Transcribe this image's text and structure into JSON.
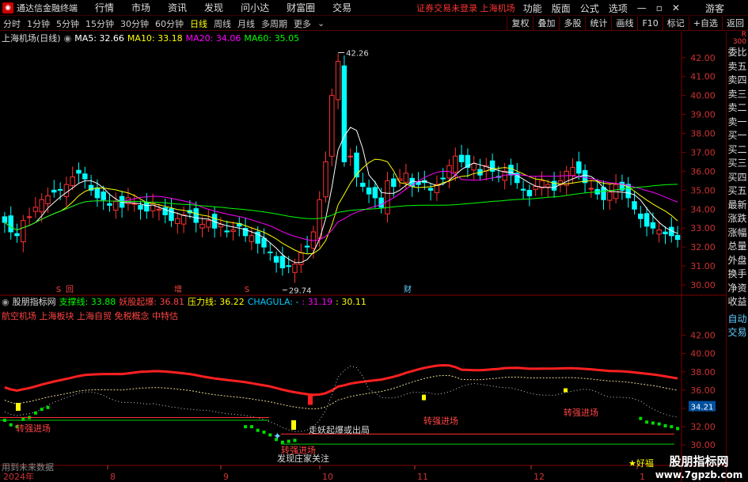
{
  "menu": {
    "app_name": "通达信金融终端",
    "items": [
      "行情",
      "市场",
      "资讯",
      "发现",
      "问小达",
      "财富圈",
      "交易"
    ],
    "status": "证券交易未登录  上海机场",
    "right_items": [
      "功能",
      "版面",
      "公式",
      "选项"
    ],
    "guest": "游客"
  },
  "period": {
    "items": [
      "分时",
      "1分钟",
      "5分钟",
      "15分钟",
      "30分钟",
      "60分钟",
      "日线",
      "周线",
      "月线",
      "多周期",
      "更多"
    ],
    "active_index": 6,
    "tools": [
      "复权",
      "叠加",
      "多股",
      "统计",
      "画线",
      "F10",
      "标记",
      "+自选",
      "返回"
    ]
  },
  "main_legend": {
    "title": "上海机场(日线)",
    "ma5": "MA5: 32.66",
    "ma10": "MA10: 33.18",
    "ma20": "MA20: 34.06",
    "ma60": "MA60: 35.05",
    "colors": {
      "ma5": "#ffffff",
      "ma10": "#ffff00",
      "ma20": "#ff00ff",
      "ma60": "#00ff00"
    }
  },
  "main_axis": {
    "ticks": [
      "42.00",
      "41.00",
      "40.00",
      "39.00",
      "38.00",
      "37.00",
      "36.00",
      "35.00",
      "34.00",
      "33.00",
      "32.00",
      "31.00",
      "30.00"
    ],
    "min": 29.5,
    "max": 42.7
  },
  "annotations": {
    "high": "42.26",
    "low": "29.74",
    "markers": [
      "S",
      "回",
      "增",
      "S",
      "财"
    ]
  },
  "sub_legend": {
    "title": "股朋指标网",
    "support": "支撑线: 33.88",
    "breakout": "妖股起爆: 36.81",
    "pressure": "压力线: 36.22",
    "chagula": "CHAGULA: - ",
    "v1": ": 31.19",
    "v2": ": 30.11"
  },
  "concepts": "航空机场  上海板块  上海自贸  免税概念  中特估",
  "sub_axis": {
    "ticks": [
      "42.00",
      "40.00",
      "38.00",
      "36.00",
      "34.00",
      "32.00",
      "30.00"
    ],
    "current": "34.21"
  },
  "sub_labels": {
    "entry1": "转强进场",
    "entry2": "转强进场",
    "entry3": "转强进场",
    "entry4": "转强进场",
    "trigger": "走妖起爆或出局",
    "watch": "发现庄家关注",
    "good": "★好福"
  },
  "x_axis": {
    "year": "2024年",
    "months": [
      "8",
      "9",
      "10",
      "11",
      "12",
      "1"
    ]
  },
  "footer": "用到未来数据",
  "right_panel": {
    "head": "R",
    "head2": "300",
    "items": [
      "委比",
      "卖五",
      "卖四",
      "卖三",
      "卖二",
      "卖一",
      "买一",
      "买二",
      "买三",
      "买四",
      "买五",
      "最新",
      "涨跌",
      "涨幅",
      "总量",
      "外盘",
      "换手",
      "净资",
      "收益"
    ],
    "bottom": [
      "自动",
      "交易"
    ]
  },
  "watermark": {
    "title": "股朋指标网",
    "url": "www.7gpzb.com"
  },
  "chart_data": {
    "type": "candlestick",
    "ylim": [
      29.5,
      42.7
    ],
    "close": [
      33.3,
      32.8,
      32.6,
      33.4,
      33.6,
      34.1,
      34.5,
      34.7,
      34.9,
      35.0,
      35.3,
      35.7,
      35.9,
      35.6,
      35.0,
      34.6,
      34.5,
      34.2,
      34.4,
      34.1,
      34.6,
      34.3,
      34.0,
      33.9,
      34.3,
      34.0,
      33.7,
      33.4,
      33.5,
      33.7,
      33.8,
      33.3,
      33.2,
      33.4,
      33.0,
      33.2,
      32.8,
      32.9,
      33.1,
      32.6,
      32.6,
      32.2,
      32.0,
      31.7,
      31.2,
      30.9,
      31.0,
      31.1,
      31.7,
      32.0,
      32.8,
      34.5,
      36.5,
      40.0,
      41.8,
      36.5,
      36.8,
      35.7,
      35.2,
      34.8,
      34.6,
      34.1,
      35.5,
      35.2,
      35.6,
      35.9,
      35.2,
      35.3,
      35.4,
      35.0,
      35.3,
      35.6,
      36.3,
      36.8,
      36.5,
      36.2,
      36.4,
      35.8,
      36.3,
      36.0,
      35.7,
      36.0,
      35.8,
      35.4,
      35.0,
      34.7,
      35.2,
      35.5,
      35.3,
      35.0,
      35.5,
      36.0,
      36.2,
      35.9,
      35.4,
      35.1,
      34.8,
      34.5,
      34.9,
      35.3,
      35.0,
      34.6,
      34.0,
      33.5,
      33.1,
      33.0,
      32.9,
      32.7,
      32.6,
      32.4
    ],
    "ma5": [
      32.66
    ],
    "ma10": [
      33.18
    ],
    "ma20": [
      34.06
    ],
    "ma60": [
      35.05
    ]
  }
}
